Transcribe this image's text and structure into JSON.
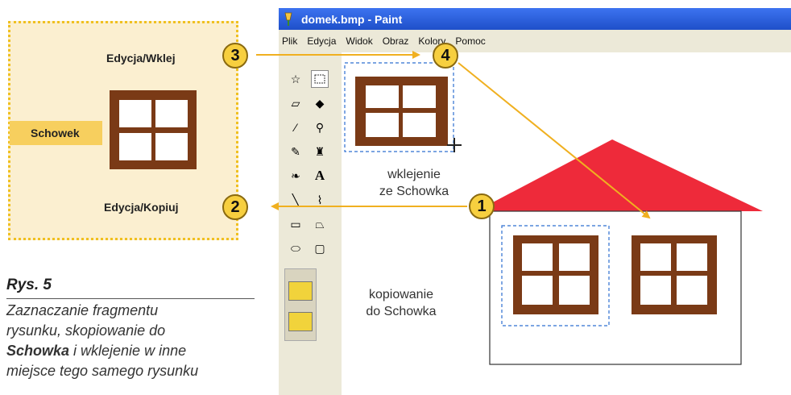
{
  "clipboard": {
    "paste_label": "Edycja/Wklej",
    "copy_label": "Edycja/Kopiuj",
    "clipboard_label": "Schowek"
  },
  "caption": {
    "title": "Rys. 5",
    "line1": "Zaznaczanie fragmentu",
    "line2": "rysunku, skopiowanie do",
    "line3_bold": "Schowka",
    "line3_rest": " i wklejenie w inne",
    "line4": "miejsce tego samego rysunku"
  },
  "window": {
    "title": "domek.bmp - Paint",
    "menu": [
      "Plik",
      "Edycja",
      "Widok",
      "Obraz",
      "Kolory",
      "Pomoc"
    ]
  },
  "canvas": {
    "paste_text_1": "wklejenie",
    "paste_text_2": "ze Schowka",
    "copy_text_1": "kopiowanie",
    "copy_text_2": "do Schowka"
  },
  "steps": [
    "1",
    "2",
    "3",
    "4"
  ],
  "colors": {
    "frame": "#7a3a16",
    "roof": "#ee2a3a",
    "badge": "#f7cf3f",
    "arrow": "#f0b020",
    "selection": "#2d6fd0",
    "panel": "#fbefd0"
  }
}
